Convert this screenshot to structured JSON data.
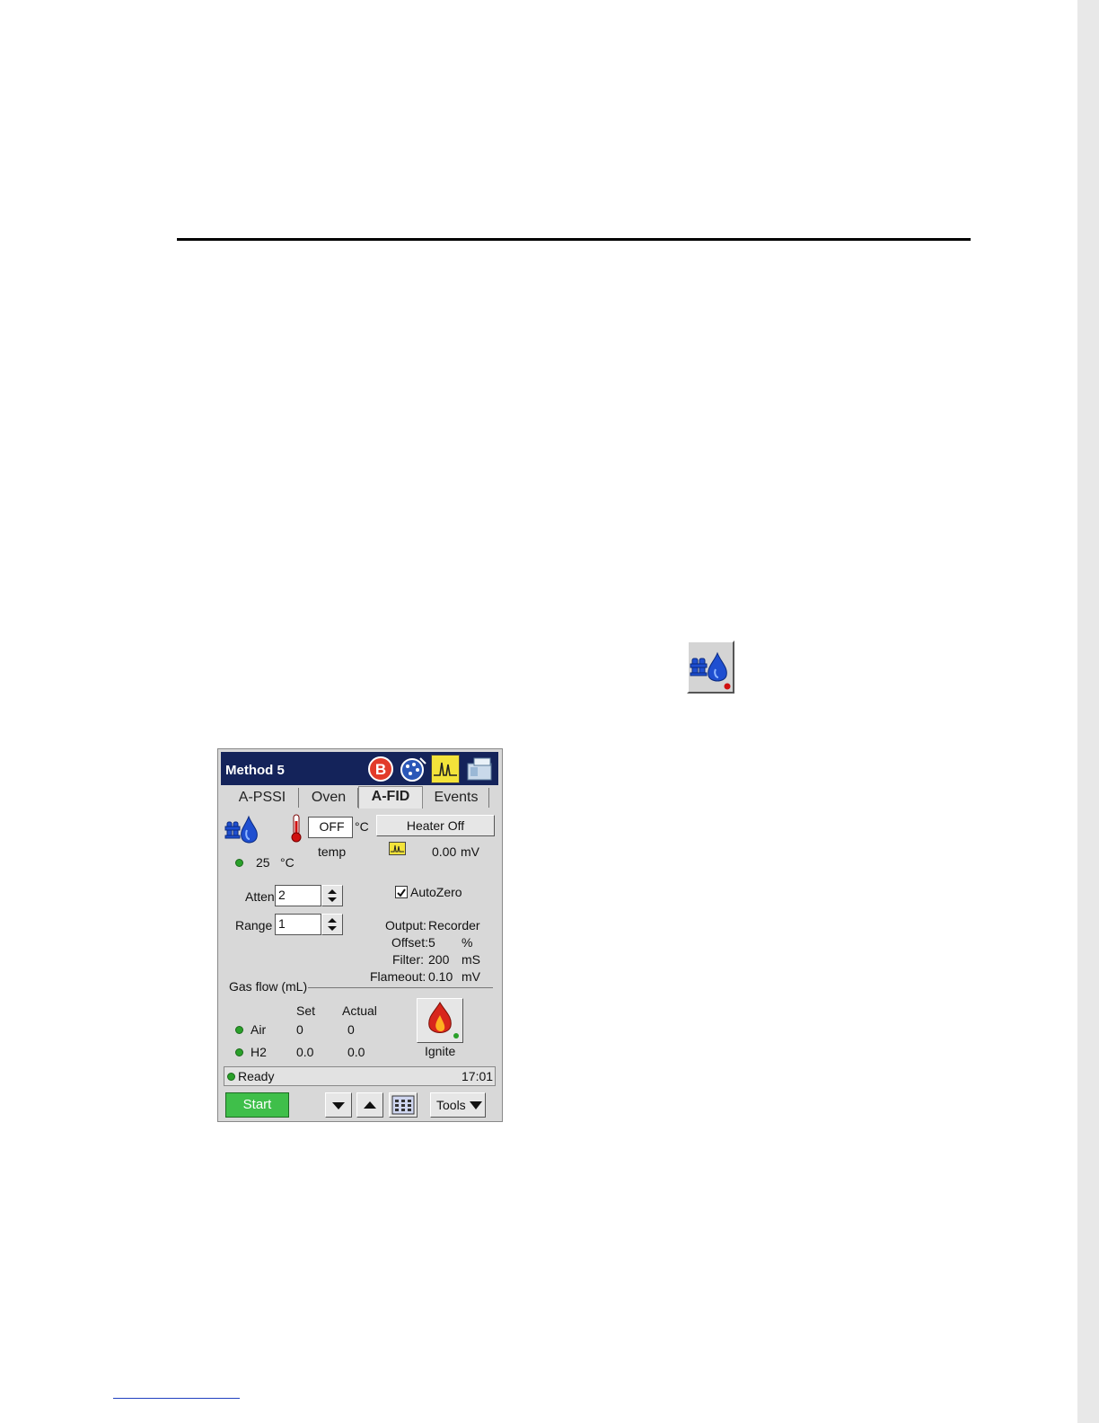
{
  "screen": {
    "title": "Method 5",
    "titlebar_icons": [
      "bypass-icon",
      "valve-icon",
      "signal-icon",
      "instrument-icon"
    ],
    "tabs": [
      "A-PSSI",
      "Oven",
      "A-FID",
      "Events"
    ],
    "active_tab": "A-FID",
    "detector": {
      "temp_value": "OFF",
      "temp_unit": "°C",
      "temp_label": "temp",
      "heater_button": "Heater Off",
      "actual_temp": "25",
      "actual_temp_unit": "°C",
      "signal_value": "0.00",
      "signal_unit": "mV"
    },
    "atten_label": "Atten",
    "atten_value": "2",
    "range_label": "Range",
    "range_value": "1",
    "autozero_label": "AutoZero",
    "autozero_checked": true,
    "output": {
      "output_label": "Output:",
      "output_value": "Recorder",
      "offset_label": "Offset:",
      "offset_value": "5",
      "offset_unit": "%",
      "filter_label": "Filter:",
      "filter_value": "200",
      "filter_unit": "mS",
      "flameout_label": "Flameout:",
      "flameout_value": "0.10",
      "flameout_unit": "mV"
    },
    "gas_flow": {
      "heading": "Gas flow (mL)",
      "col_set": "Set",
      "col_actual": "Actual",
      "rows": [
        {
          "name": "Air",
          "set": "0",
          "actual": "0"
        },
        {
          "name": "H2",
          "set": "0.0",
          "actual": "0.0"
        }
      ]
    },
    "ignite_label": "Ignite",
    "status": {
      "text": "Ready",
      "time": "17:01"
    },
    "bottom": {
      "start": "Start",
      "tools": "Tools"
    }
  },
  "colors": {
    "titlebar": "#14235a",
    "start_button": "#3fbf4a",
    "led_green": "#2aa02a",
    "led_red": "#d01010",
    "flame_blue": "#1f4fd0"
  }
}
